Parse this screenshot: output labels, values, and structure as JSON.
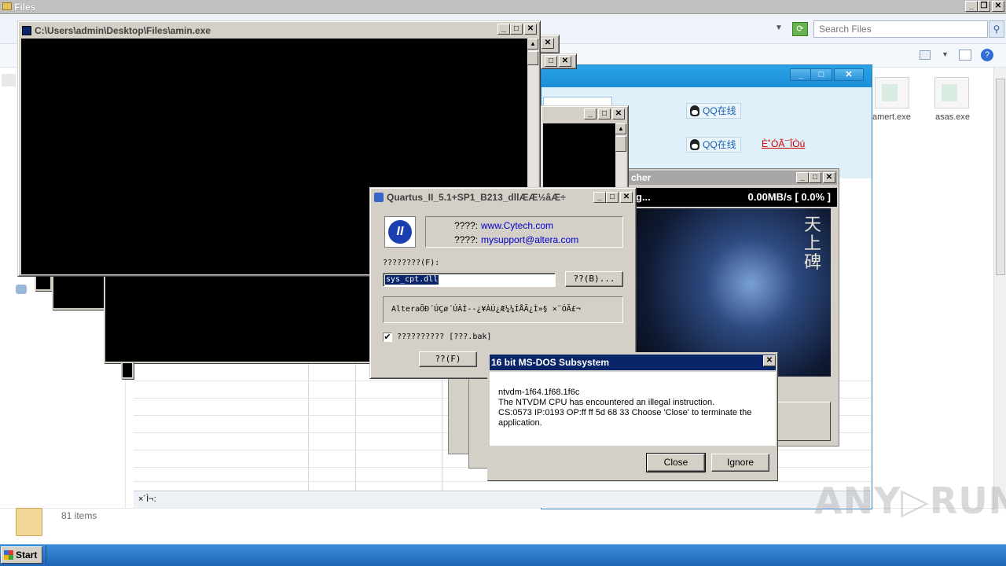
{
  "explorer": {
    "title": "Files",
    "search_placeholder": "Search Files",
    "status_count": "81 items",
    "files": [
      "amert.exe",
      "asas.exe"
    ]
  },
  "console_window": {
    "title": "C:\\Users\\admin\\Desktop\\Files\\amin.exe"
  },
  "qq_window": {
    "badge1": "QQ在线",
    "badge2": "QQ在线",
    "link": "È˚ÓÃ¯ÎÒú"
  },
  "launcher": {
    "title": "cher",
    "progress_left": "g...",
    "progress_right": "0.00MB/s [ 0.0% ]",
    "art_calligraphy": "天上碑"
  },
  "quartus": {
    "title": "Quartus_II_5.1+SP1_B213_dllÆÆ½âÆ÷",
    "label1": "????:",
    "link1": "www.Cytech.com",
    "label2": "????:",
    "link2": "mysupport@altera.com",
    "file_label": "????????(F):",
    "file_value": "sys_cpt.dll",
    "browse_button": "??(B)...",
    "description": "AlteraÕÐ´ÚÇø´ÚÀÍ--¿¥ÀÚ¿Æ¼¼ÍÅÃ¿Ì»§ ×¨ÓÃ£¬",
    "checkbox_label": "?????????? [???.bak]",
    "checkbox_checked": "✔",
    "ok_button": "??(F)"
  },
  "ntvdm": {
    "title": "16 bit MS-DOS Subsystem",
    "lines": [
      "ntvdm-1f64.1f68.1f6c",
      "The NTVDM CPU has encountered an illegal instruction.",
      "CS:0573 IP:0193 OP:ff ff 5d 68 33 Choose 'Close' to terminate the",
      "application."
    ],
    "close_button": "Close",
    "ignore_button": "Ignore"
  },
  "grid_status": "×´Ì¬:",
  "taskbar": {
    "start_label": "Start"
  },
  "watermark": "ANY▷RUN",
  "window_buttons": {
    "min": "_",
    "max": "□",
    "close": "✕",
    "restore": "❐"
  },
  "icons": {
    "search": "⚲",
    "refresh": "⟳",
    "dropdown": "▼"
  },
  "colors": {
    "title_active": "#0a246a",
    "qq_blue": "#1b8fd9",
    "link_blue": "#0000cc",
    "link_red": "#cc0000"
  }
}
